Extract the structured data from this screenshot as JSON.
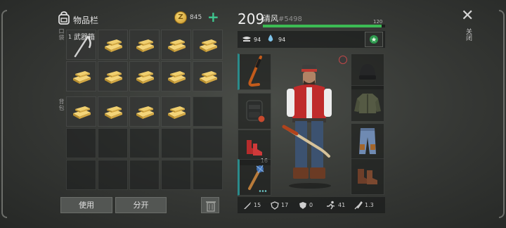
{
  "inventory": {
    "title": "物品栏",
    "coin_count": "845",
    "coin_symbol": "Z",
    "pocket_label": "口袋",
    "backpack_label": "背包",
    "weapon_box_label": "武器箱",
    "weapon_box_count": "1",
    "pocket_cells": [
      "weapon-box",
      "bricks",
      "bricks",
      "bricks",
      "bricks",
      "bricks",
      "bricks",
      "bricks",
      "bricks",
      "bricks"
    ],
    "backpack_cells": [
      "bricks",
      "bricks",
      "bricks",
      "bricks",
      "empty",
      "empty",
      "empty",
      "empty",
      "empty",
      "empty",
      "empty",
      "empty",
      "empty",
      "empty",
      "empty"
    ],
    "use_label": "使用",
    "split_label": "分开"
  },
  "character": {
    "level": "209",
    "name": "清风",
    "id": "#5498",
    "xp_max": "120",
    "xp_fraction": 0.97,
    "food": "94",
    "water": "94",
    "boots_slot_count": "16"
  },
  "stats": {
    "attack": "15",
    "armor": "17",
    "defense": "0",
    "speed": "41",
    "damage_mult": "1.3"
  },
  "ui": {
    "close_label": "关闭"
  },
  "colors": {
    "xp": "#3cbb54",
    "accent": "#3fc890",
    "weapon_slot": "#2a8b8b"
  }
}
